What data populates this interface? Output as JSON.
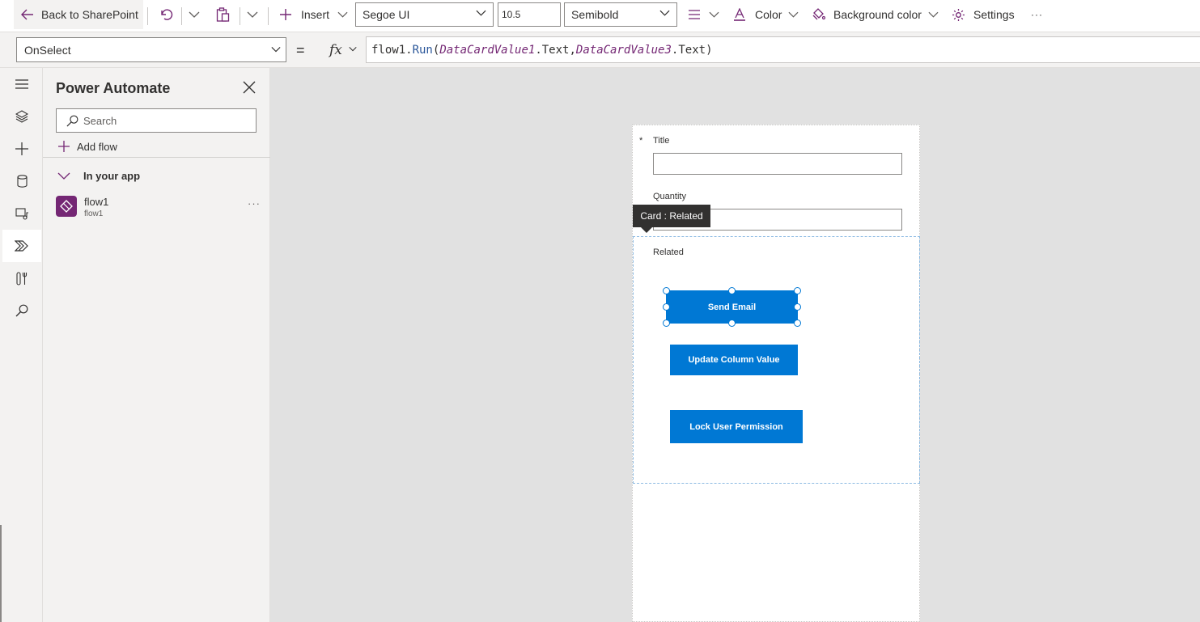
{
  "toolbar": {
    "back_label": "Back to SharePoint",
    "insert_label": "Insert",
    "font_family": "Segoe UI",
    "font_size": "10.5",
    "font_weight": "Semibold",
    "color_label": "Color",
    "bg_color_label": "Background color",
    "settings_label": "Settings",
    "more_label": "···"
  },
  "formula_bar": {
    "property": "OnSelect",
    "equals": "=",
    "fx": "fx",
    "tokens": {
      "t1": "flow1.",
      "t2": "Run",
      "t3": "(",
      "t4": "DataCardValue1",
      "t5": ".Text,",
      "t6": "DataCardValue3",
      "t7": ".Text)"
    }
  },
  "pane": {
    "title": "Power Automate",
    "search_placeholder": "Search",
    "add_flow_label": "Add flow",
    "section_label": "In your app",
    "flows": [
      {
        "name": "flow1",
        "subtitle": "flow1",
        "more": "···"
      }
    ]
  },
  "screen": {
    "required_marker": "*",
    "title_label": "Title",
    "quantity_label": "Quantity",
    "tooltip": "Card : Related",
    "related_label": "Related",
    "buttons": {
      "send_email": "Send Email",
      "update_column": "Update Column Value",
      "lock_permission": "Lock User Permission"
    }
  },
  "colors": {
    "accent_purple": "#742774",
    "button_blue": "#0078d4",
    "selection_blue": "#0078d4",
    "canvas_gray": "#e1e1e1"
  },
  "icons": {
    "rail": [
      "hamburger-icon",
      "layers-icon",
      "plus-icon",
      "database-icon",
      "media-icon",
      "power-automate-icon",
      "tools-icon",
      "search-icon"
    ]
  }
}
